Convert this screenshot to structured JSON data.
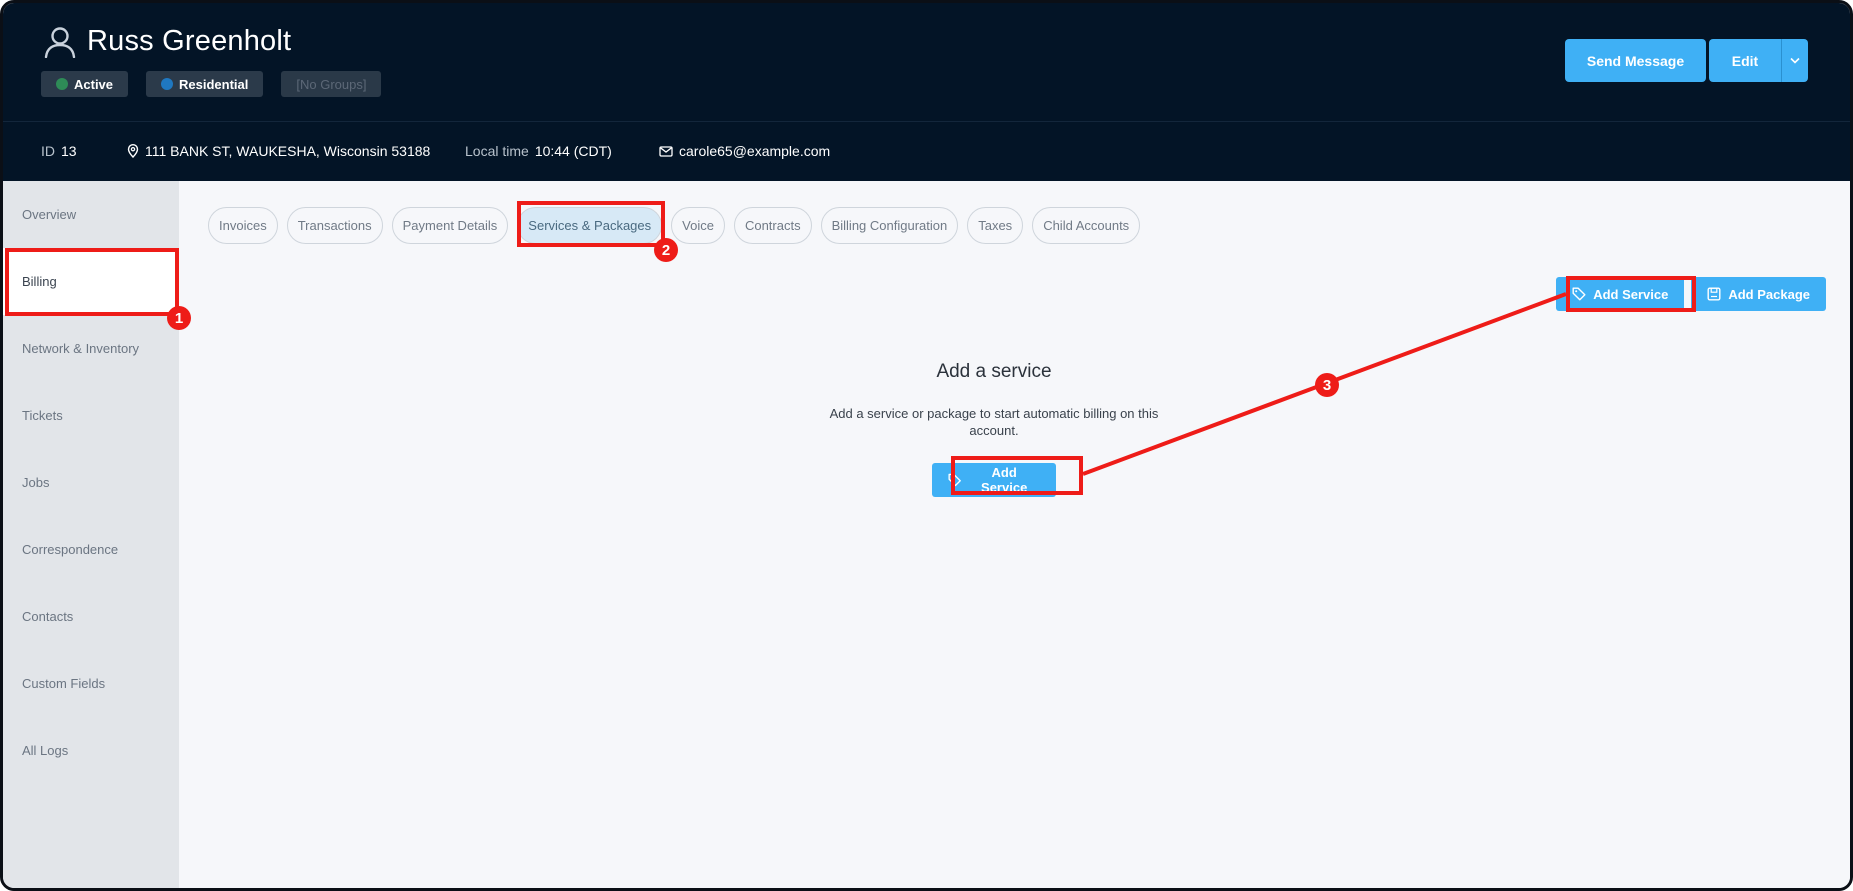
{
  "customer": {
    "name": "Russ Greenholt",
    "badges": [
      {
        "label": "Active",
        "dot_color": "#2e8b57"
      },
      {
        "label": "Residential",
        "dot_color": "#1f78c1"
      },
      {
        "label": "[No Groups]"
      }
    ],
    "id_label": "ID",
    "id_value": "13",
    "address": "111 BANK ST, WAUKESHA, Wisconsin 53188",
    "local_time_label": "Local time",
    "local_time_value": "10:44 (CDT)",
    "email": "carole65@example.com"
  },
  "header_actions": {
    "send_message": "Send Message",
    "edit": "Edit"
  },
  "sidebar": {
    "items": [
      {
        "label": "Overview"
      },
      {
        "label": "Billing",
        "active": true
      },
      {
        "label": "Network & Inventory"
      },
      {
        "label": "Tickets"
      },
      {
        "label": "Jobs"
      },
      {
        "label": "Correspondence"
      },
      {
        "label": "Contacts"
      },
      {
        "label": "Custom Fields"
      },
      {
        "label": "All Logs"
      }
    ]
  },
  "billing_tabs": [
    {
      "label": "Invoices"
    },
    {
      "label": "Transactions"
    },
    {
      "label": "Payment Details"
    },
    {
      "label": "Services & Packages",
      "active": true
    },
    {
      "label": "Voice"
    },
    {
      "label": "Contracts"
    },
    {
      "label": "Billing Configuration"
    },
    {
      "label": "Taxes"
    },
    {
      "label": "Child Accounts"
    }
  ],
  "actions": {
    "add_service": "Add Service",
    "add_package": "Add Package"
  },
  "empty_state": {
    "title": "Add a service",
    "text": "Add a service or package to start automatic billing on this account.",
    "button": "Add Service"
  },
  "annotations": {
    "color": "#ee1c18",
    "markers": [
      "1",
      "2",
      "3"
    ]
  },
  "colors": {
    "header_bg": "#031426",
    "accent": "#3fb0f5",
    "sidebar_bg": "#e2e5e9",
    "content_bg": "#f6f7fa"
  }
}
